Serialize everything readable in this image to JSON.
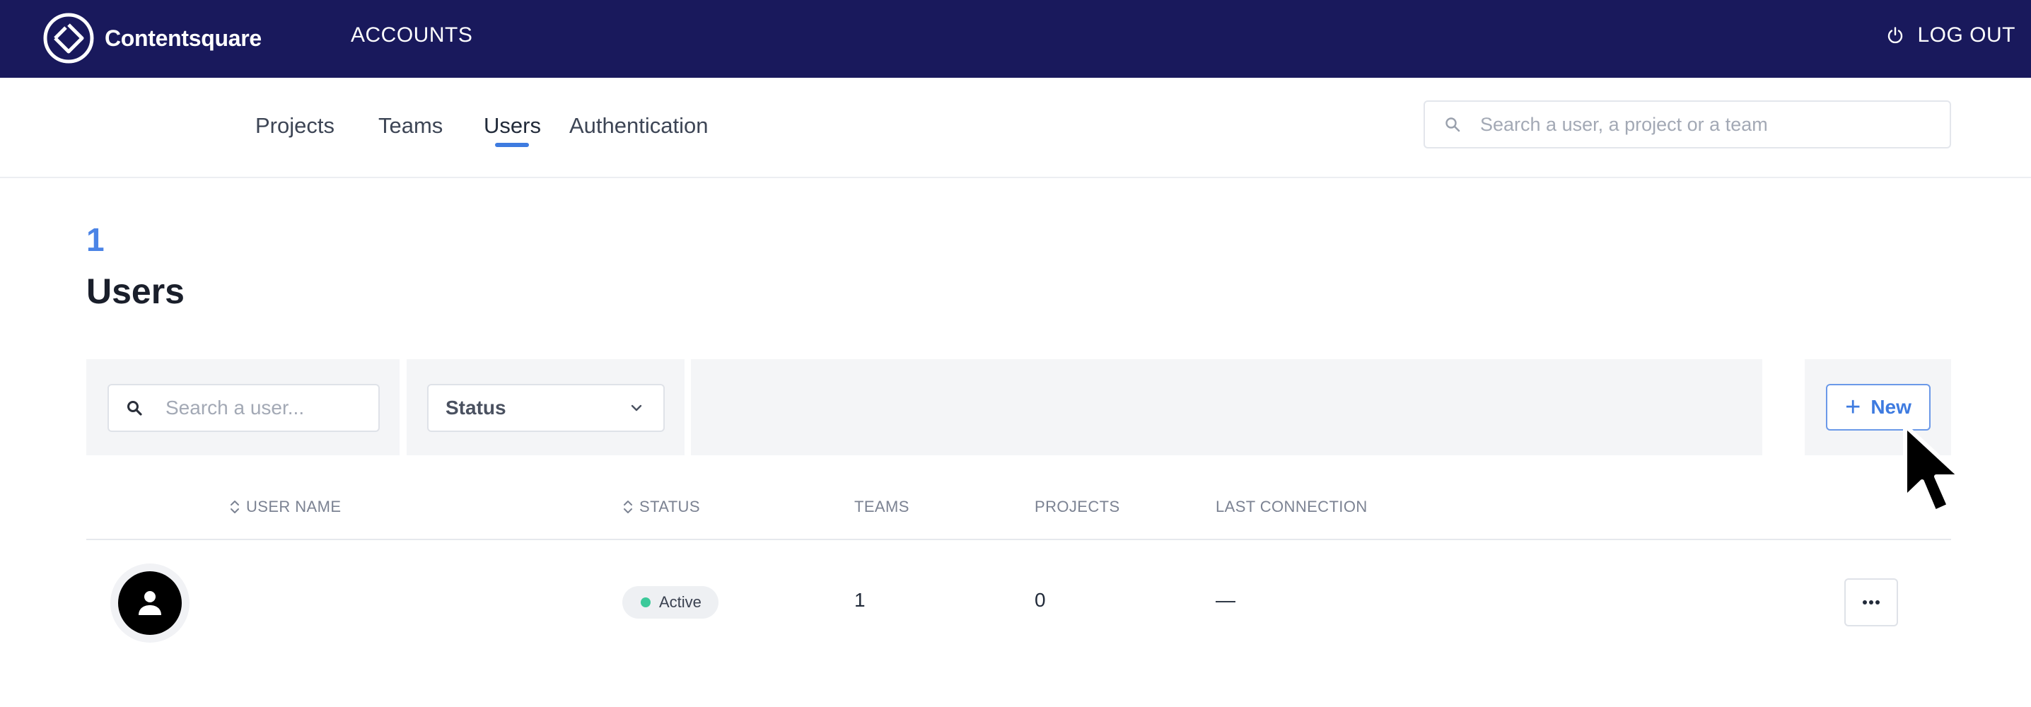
{
  "topbar": {
    "brand": "Contentsquare",
    "accounts_label": "ACCOUNTS",
    "logout_label": "LOG OUT",
    "background": "#19195c",
    "icons": {
      "logo": "contentsquare-logo-icon",
      "logout": "power-icon"
    }
  },
  "subnav": {
    "tabs": [
      {
        "label": "Projects",
        "active": false
      },
      {
        "label": "Teams",
        "active": false
      },
      {
        "label": "Users",
        "active": true
      },
      {
        "label": "Authentication",
        "active": false
      }
    ],
    "search": {
      "placeholder": "Search a user, a project or a team",
      "value": "",
      "icon": "search-icon"
    },
    "accent": "#3e7be0"
  },
  "page": {
    "count": "1",
    "title": "Users"
  },
  "filters": {
    "search_placeholder": "Search a user...",
    "search_value": "",
    "status_label": "Status",
    "new_label": "New"
  },
  "table": {
    "headers": {
      "user_name": "USER NAME",
      "status": "STATUS",
      "teams": "TEAMS",
      "projects": "PROJECTS",
      "last_connection": "LAST CONNECTION"
    },
    "rows": [
      {
        "user_name": "",
        "status": "Active",
        "teams": "1",
        "projects": "0",
        "last_connection": "—",
        "status_color": "#3cc99a"
      }
    ]
  }
}
